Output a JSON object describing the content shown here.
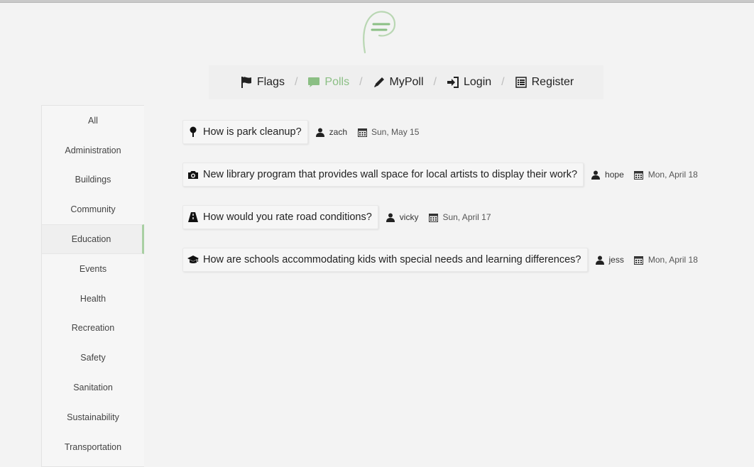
{
  "colors": {
    "accent": "#8bbf84",
    "sidebar_active_border": "#a9d0a3"
  },
  "nav": {
    "items": [
      {
        "label": "Flags",
        "icon": "flag-icon"
      },
      {
        "label": "Polls",
        "icon": "comment-icon",
        "active": true
      },
      {
        "label": "MyPoll",
        "icon": "pencil-icon"
      },
      {
        "label": "Login",
        "icon": "login-icon"
      },
      {
        "label": "Register",
        "icon": "list-icon"
      }
    ],
    "separator": "/"
  },
  "sidebar": {
    "categories": [
      {
        "label": "All"
      },
      {
        "label": "Administration"
      },
      {
        "label": "Buildings"
      },
      {
        "label": "Community"
      },
      {
        "label": "Education",
        "active": true
      },
      {
        "label": "Events"
      },
      {
        "label": "Health"
      },
      {
        "label": "Recreation"
      },
      {
        "label": "Safety"
      },
      {
        "label": "Sanitation"
      },
      {
        "label": "Sustainability"
      },
      {
        "label": "Transportation"
      }
    ]
  },
  "polls": [
    {
      "icon": "tree-icon",
      "question": "How is park cleanup?",
      "user": "zach",
      "date": "Sun, May 15"
    },
    {
      "icon": "camera-icon",
      "question": "New library program that provides wall space for local artists to display their work?",
      "user": "hope",
      "date": "Mon, April 18"
    },
    {
      "icon": "road-icon",
      "question": "How would you rate road conditions?",
      "user": "vicky",
      "date": "Sun, April 17"
    },
    {
      "icon": "graduation-cap-icon",
      "question": "How are schools accommodating kids with special needs and learning differences?",
      "user": "jess",
      "date": "Mon, April 18"
    }
  ]
}
